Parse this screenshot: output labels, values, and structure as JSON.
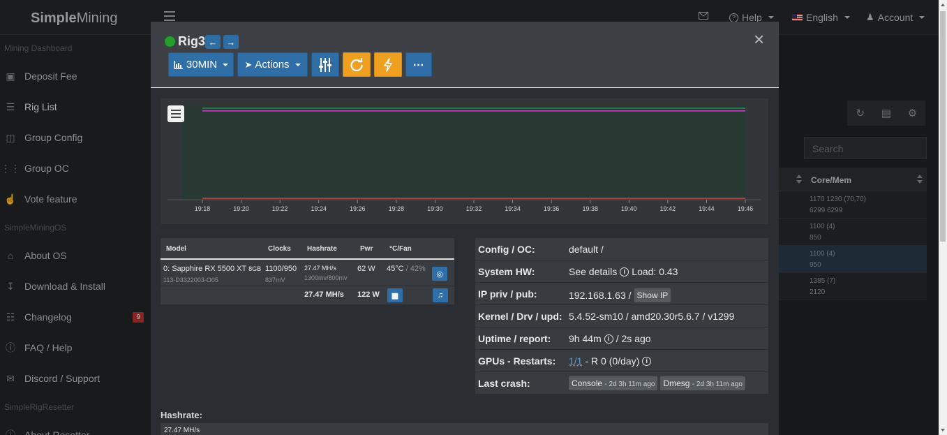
{
  "app": {
    "brand_bold": "Simple",
    "brand_rest": "Mining"
  },
  "topnav": {
    "help": "Help",
    "language": "English",
    "account": "Account"
  },
  "sidebar": {
    "sections": [
      "Mining Dashboard",
      "SimpleMiningOS",
      "SimpleRigResetter"
    ],
    "items": [
      {
        "label": "Deposit Fee",
        "icon": "money-icon"
      },
      {
        "label": "Rig List",
        "icon": "list-icon"
      },
      {
        "label": "Group Config",
        "icon": "group-config-icon"
      },
      {
        "label": "Group OC",
        "icon": "sliders-icon"
      },
      {
        "label": "Vote feature",
        "icon": "thumbs-up-icon"
      },
      {
        "label": "About OS",
        "icon": "home-icon"
      },
      {
        "label": "Download & Install",
        "icon": "download-icon"
      },
      {
        "label": "Changelog",
        "icon": "changelog-icon",
        "badge": "9"
      },
      {
        "label": "FAQ / Help",
        "icon": "question-icon"
      },
      {
        "label": "Discord / Support",
        "icon": "chat-icon"
      },
      {
        "label": "About Resetter",
        "icon": "info-icon"
      }
    ]
  },
  "right_panel": {
    "search_placeholder": "Search",
    "column": "Core/Mem",
    "rows": [
      {
        "line1": "1170 1230 (70,70)",
        "line2": "6299 6299"
      },
      {
        "line1": "1100 (4)",
        "line2": "850"
      },
      {
        "line1": "1100 (4)",
        "line2": "950"
      },
      {
        "line1": "1385 (7)",
        "line2": "2120"
      }
    ]
  },
  "modal": {
    "rig_name": "Rig3",
    "status_color": "#22a02a",
    "buttons": {
      "timeframe": "30MIN",
      "actions": "Actions"
    },
    "close": "×",
    "chart_data": {
      "type": "line",
      "x": [
        "19:18",
        "19:20",
        "19:22",
        "19:24",
        "19:26",
        "19:28",
        "19:30",
        "19:32",
        "19:34",
        "19:36",
        "19:38",
        "19:40",
        "19:42",
        "19:44",
        "19:46"
      ],
      "series": [
        {
          "color": "#cc44cc",
          "values": [
            0.97,
            0.97,
            0.97,
            0.97,
            0.97,
            0.97,
            0.97,
            0.97,
            0.97,
            0.97,
            0.97,
            0.97,
            0.97,
            0.97,
            0.97
          ]
        },
        {
          "color": "#2e8b57",
          "values": [
            1.0,
            1.0,
            1.0,
            1.0,
            1.0,
            1.0,
            1.0,
            1.0,
            1.0,
            1.0,
            1.0,
            1.0,
            1.0,
            1.0,
            1.0
          ]
        },
        {
          "color": "#d94040",
          "values": [
            0,
            0,
            0,
            0,
            0,
            0,
            0,
            0,
            0,
            0,
            0,
            0,
            0,
            0,
            0
          ]
        }
      ],
      "ylim": [
        0,
        1.0
      ],
      "grid": false
    },
    "gpu_table": {
      "headers": {
        "model": "Model",
        "clocks": "Clocks",
        "hashrate": "Hashrate",
        "pwr": "Pwr",
        "temp_fan": "°C/Fan"
      },
      "row": {
        "model": "0: Sapphire RX 5500 XT",
        "mem_size": "8GB",
        "bios": "113-D3322003-O05",
        "clocks": "1100/950",
        "voltage": "837mV",
        "hashrate": "27.47 MH/s",
        "hash_sub": "1300mv/800mv",
        "power": "62 W",
        "temp": "45°C",
        "fan": "/ 42%"
      },
      "totals": {
        "hashrate": "27.47 MH/s",
        "power": "122 W"
      }
    },
    "info": {
      "config_label": "Config / OC:",
      "config_value": "default /",
      "hw_label": "System HW:",
      "hw_details": "See details",
      "hw_load": "Load: 0.43",
      "ip_label": "IP priv / pub:",
      "ip_value": "192.168.1.63 /",
      "ip_button": "Show IP",
      "kernel_label": "Kernel / Drv / upd:",
      "kernel_value": "5.4.52-sm10 / amd20.30r5.6.7 / v1299",
      "uptime_label": "Uptime / report:",
      "uptime_value": "9h 44m",
      "report_value": "/ 2s ago",
      "gpus_label": "GPUs - Restarts:",
      "gpus_link": "1/1",
      "gpus_rest": "- R 0 (0/day)",
      "crash_label": "Last crash:",
      "crash_console": "Console",
      "crash_console_time": "- 2d 3h 11m ago",
      "crash_dmesg": "Dmesg",
      "crash_dmesg_time": "- 2d 3h 11m ago"
    },
    "hashrate_label": "Hashrate:",
    "hashrate_value": "27.47 MH/s"
  }
}
